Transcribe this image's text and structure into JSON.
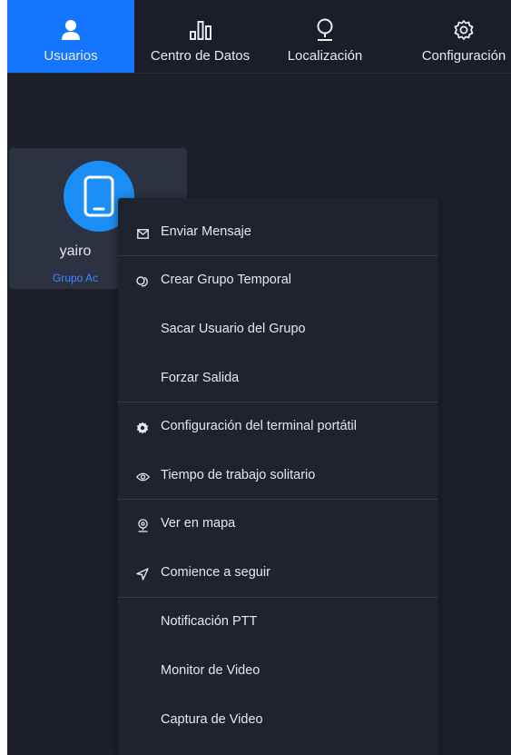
{
  "nav": {
    "tabs": [
      {
        "label": "Usuarios",
        "icon": "user-icon",
        "active": true
      },
      {
        "label": "Centro de Datos",
        "icon": "bar-chart-icon",
        "active": false
      },
      {
        "label": "Localización",
        "icon": "location-pin-icon",
        "active": false
      },
      {
        "label": "Configuración",
        "icon": "gear-icon",
        "active": false
      }
    ]
  },
  "user_card": {
    "name": "yairo",
    "group": "Grupo Ac",
    "avatar_icon": "mobile-phone-icon"
  },
  "context_menu": {
    "items": [
      {
        "label": "Enviar Mensaje",
        "icon": "envelope-icon"
      },
      {
        "label": "Crear Grupo Temporal",
        "icon": "group-link-icon"
      },
      {
        "label": "Sacar Usuario del Grupo",
        "icon": ""
      },
      {
        "label": "Forzar Salida",
        "icon": ""
      },
      {
        "label": "Configuración del terminal portátil",
        "icon": "gear-icon"
      },
      {
        "label": "Tiempo de trabajo solitario",
        "icon": "eye-icon"
      },
      {
        "label": "Ver en mapa",
        "icon": "map-pin-icon"
      },
      {
        "label": "Comience a seguir",
        "icon": "navigation-arrow-icon"
      },
      {
        "label": "Notificación PTT",
        "icon": ""
      },
      {
        "label": "Monitor de Video",
        "icon": ""
      },
      {
        "label": "Captura de Video",
        "icon": ""
      }
    ]
  },
  "colors": {
    "accent": "#1476ff",
    "background": "#1d2029",
    "menu_bg": "#1f232e",
    "card_bg": "#2c3241",
    "avatar_bg": "#1b8ff5",
    "group_text": "#3d8cff"
  }
}
